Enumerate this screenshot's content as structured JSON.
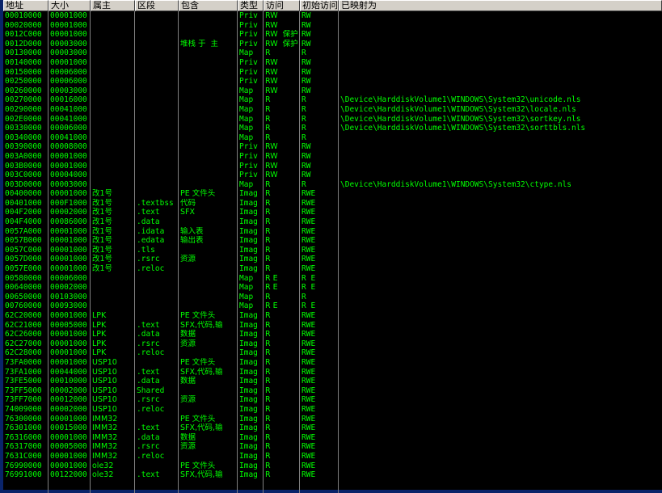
{
  "columns": [
    {
      "key": "addr",
      "label": "地址"
    },
    {
      "key": "size",
      "label": "大小"
    },
    {
      "key": "owner",
      "label": "属主"
    },
    {
      "key": "section",
      "label": "区段"
    },
    {
      "key": "contains",
      "label": "包含"
    },
    {
      "key": "type",
      "label": "类型"
    },
    {
      "key": "access",
      "label": "访问"
    },
    {
      "key": "initial",
      "label": "初始访问"
    },
    {
      "key": "mapped",
      "label": "已映射为"
    }
  ],
  "rows": [
    [
      "00010000",
      "00001000",
      "",
      "",
      "",
      "Priv",
      "RW",
      "RW",
      ""
    ],
    [
      "00020000",
      "00001000",
      "",
      "",
      "",
      "Priv",
      "RW",
      "RW",
      ""
    ],
    [
      "0012C000",
      "00001000",
      "",
      "",
      "",
      "Priv",
      "RW  保护",
      "RW",
      ""
    ],
    [
      "0012D000",
      "00003000",
      "",
      "",
      "堆栈 于  主",
      "Priv",
      "RW  保护",
      "RW",
      ""
    ],
    [
      "00130000",
      "00003000",
      "",
      "",
      "",
      "Map",
      "R",
      "R",
      ""
    ],
    [
      "00140000",
      "00001000",
      "",
      "",
      "",
      "Priv",
      "RW",
      "RW",
      ""
    ],
    [
      "00150000",
      "00006000",
      "",
      "",
      "",
      "Priv",
      "RW",
      "RW",
      ""
    ],
    [
      "00250000",
      "00006000",
      "",
      "",
      "",
      "Priv",
      "RW",
      "RW",
      ""
    ],
    [
      "00260000",
      "00003000",
      "",
      "",
      "",
      "Map",
      "RW",
      "RW",
      ""
    ],
    [
      "00270000",
      "00016000",
      "",
      "",
      "",
      "Map",
      "R",
      "R",
      "\\Device\\HarddiskVolume1\\WINDOWS\\System32\\unicode.nls"
    ],
    [
      "00290000",
      "00041000",
      "",
      "",
      "",
      "Map",
      "R",
      "R",
      "\\Device\\HarddiskVolume1\\WINDOWS\\System32\\locale.nls"
    ],
    [
      "002E0000",
      "00041000",
      "",
      "",
      "",
      "Map",
      "R",
      "R",
      "\\Device\\HarddiskVolume1\\WINDOWS\\System32\\sortkey.nls"
    ],
    [
      "00330000",
      "00006000",
      "",
      "",
      "",
      "Map",
      "R",
      "R",
      "\\Device\\HarddiskVolume1\\WINDOWS\\System32\\sorttbls.nls"
    ],
    [
      "00340000",
      "00041000",
      "",
      "",
      "",
      "Map",
      "R",
      "R",
      ""
    ],
    [
      "00390000",
      "00008000",
      "",
      "",
      "",
      "Priv",
      "RW",
      "RW",
      ""
    ],
    [
      "003A0000",
      "00001000",
      "",
      "",
      "",
      "Priv",
      "RW",
      "RW",
      ""
    ],
    [
      "003B0000",
      "00001000",
      "",
      "",
      "",
      "Priv",
      "RW",
      "RW",
      ""
    ],
    [
      "003C0000",
      "00004000",
      "",
      "",
      "",
      "Priv",
      "RW",
      "RW",
      ""
    ],
    [
      "003D0000",
      "00003000",
      "",
      "",
      "",
      "Map",
      "R",
      "R",
      "\\Device\\HarddiskVolume1\\WINDOWS\\System32\\ctype.nls"
    ],
    [
      "00400000",
      "00001000",
      "改1号",
      "",
      "PE 文件头",
      "Imag",
      "R",
      "RWE",
      ""
    ],
    [
      "00401000",
      "000F1000",
      "改1号",
      ".textbss",
      "代码",
      "Imag",
      "R",
      "RWE",
      ""
    ],
    [
      "004F2000",
      "00002000",
      "改1号",
      ".text",
      "SFX",
      "Imag",
      "R",
      "RWE",
      ""
    ],
    [
      "004F4000",
      "00086000",
      "改1号",
      ".data",
      "",
      "Imag",
      "R",
      "RWE",
      ""
    ],
    [
      "0057A000",
      "00001000",
      "改1号",
      ".idata",
      "输入表",
      "Imag",
      "R",
      "RWE",
      ""
    ],
    [
      "0057B000",
      "00001000",
      "改1号",
      ".edata",
      "输出表",
      "Imag",
      "R",
      "RWE",
      ""
    ],
    [
      "0057C000",
      "00001000",
      "改1号",
      ".tls",
      "",
      "Imag",
      "R",
      "RWE",
      ""
    ],
    [
      "0057D000",
      "00001000",
      "改1号",
      ".rsrc",
      "资源",
      "Imag",
      "R",
      "RWE",
      ""
    ],
    [
      "0057E000",
      "00001000",
      "改1号",
      ".reloc",
      "",
      "Imag",
      "R",
      "RWE",
      ""
    ],
    [
      "00580000",
      "00006000",
      "",
      "",
      "",
      "Map",
      "R E",
      "R E",
      ""
    ],
    [
      "00640000",
      "00002000",
      "",
      "",
      "",
      "Map",
      "R E",
      "R E",
      ""
    ],
    [
      "00650000",
      "00103000",
      "",
      "",
      "",
      "Map",
      "R",
      "R",
      ""
    ],
    [
      "00760000",
      "00093000",
      "",
      "",
      "",
      "Map",
      "R E",
      "R E",
      ""
    ],
    [
      "62C20000",
      "00001000",
      "LPK",
      "",
      "PE 文件头",
      "Imag",
      "R",
      "RWE",
      ""
    ],
    [
      "62C21000",
      "00005000",
      "LPK",
      ".text",
      "SFX,代码,输",
      "Imag",
      "R",
      "RWE",
      ""
    ],
    [
      "62C26000",
      "00001000",
      "LPK",
      ".data",
      "数据",
      "Imag",
      "R",
      "RWE",
      ""
    ],
    [
      "62C27000",
      "00001000",
      "LPK",
      ".rsrc",
      "资源",
      "Imag",
      "R",
      "RWE",
      ""
    ],
    [
      "62C28000",
      "00001000",
      "LPK",
      ".reloc",
      "",
      "Imag",
      "R",
      "RWE",
      ""
    ],
    [
      "73FA0000",
      "00001000",
      "USP10",
      "",
      "PE 文件头",
      "Imag",
      "R",
      "RWE",
      ""
    ],
    [
      "73FA1000",
      "00044000",
      "USP10",
      ".text",
      "SFX,代码,输",
      "Imag",
      "R",
      "RWE",
      ""
    ],
    [
      "73FE5000",
      "00010000",
      "USP10",
      ".data",
      "数据",
      "Imag",
      "R",
      "RWE",
      ""
    ],
    [
      "73FF5000",
      "00002000",
      "USP10",
      "Shared",
      "",
      "Imag",
      "R",
      "RWE",
      ""
    ],
    [
      "73FF7000",
      "00012000",
      "USP10",
      ".rsrc",
      "资源",
      "Imag",
      "R",
      "RWE",
      ""
    ],
    [
      "74009000",
      "00002000",
      "USP10",
      ".reloc",
      "",
      "Imag",
      "R",
      "RWE",
      ""
    ],
    [
      "76300000",
      "00001000",
      "IMM32",
      "",
      "PE 文件头",
      "Imag",
      "R",
      "RWE",
      ""
    ],
    [
      "76301000",
      "00015000",
      "IMM32",
      ".text",
      "SFX,代码,输",
      "Imag",
      "R",
      "RWE",
      ""
    ],
    [
      "76316000",
      "00001000",
      "IMM32",
      ".data",
      "数据",
      "Imag",
      "R",
      "RWE",
      ""
    ],
    [
      "76317000",
      "00005000",
      "IMM32",
      ".rsrc",
      "资源",
      "Imag",
      "R",
      "RWE",
      ""
    ],
    [
      "7631C000",
      "00001000",
      "IMM32",
      ".reloc",
      "",
      "Imag",
      "R",
      "RWE",
      ""
    ],
    [
      "76990000",
      "00001000",
      "ole32",
      "",
      "PE 文件头",
      "Imag",
      "R",
      "RWE",
      ""
    ],
    [
      "76991000",
      "00122000",
      "ole32",
      ".text",
      "SFX,代码,输",
      "Imag",
      "R",
      "RWE",
      ""
    ]
  ],
  "colors": {
    "background": "#000000",
    "text": "#00ff00",
    "header_bg": "#d4d0c8",
    "edge": "#0a246a"
  }
}
